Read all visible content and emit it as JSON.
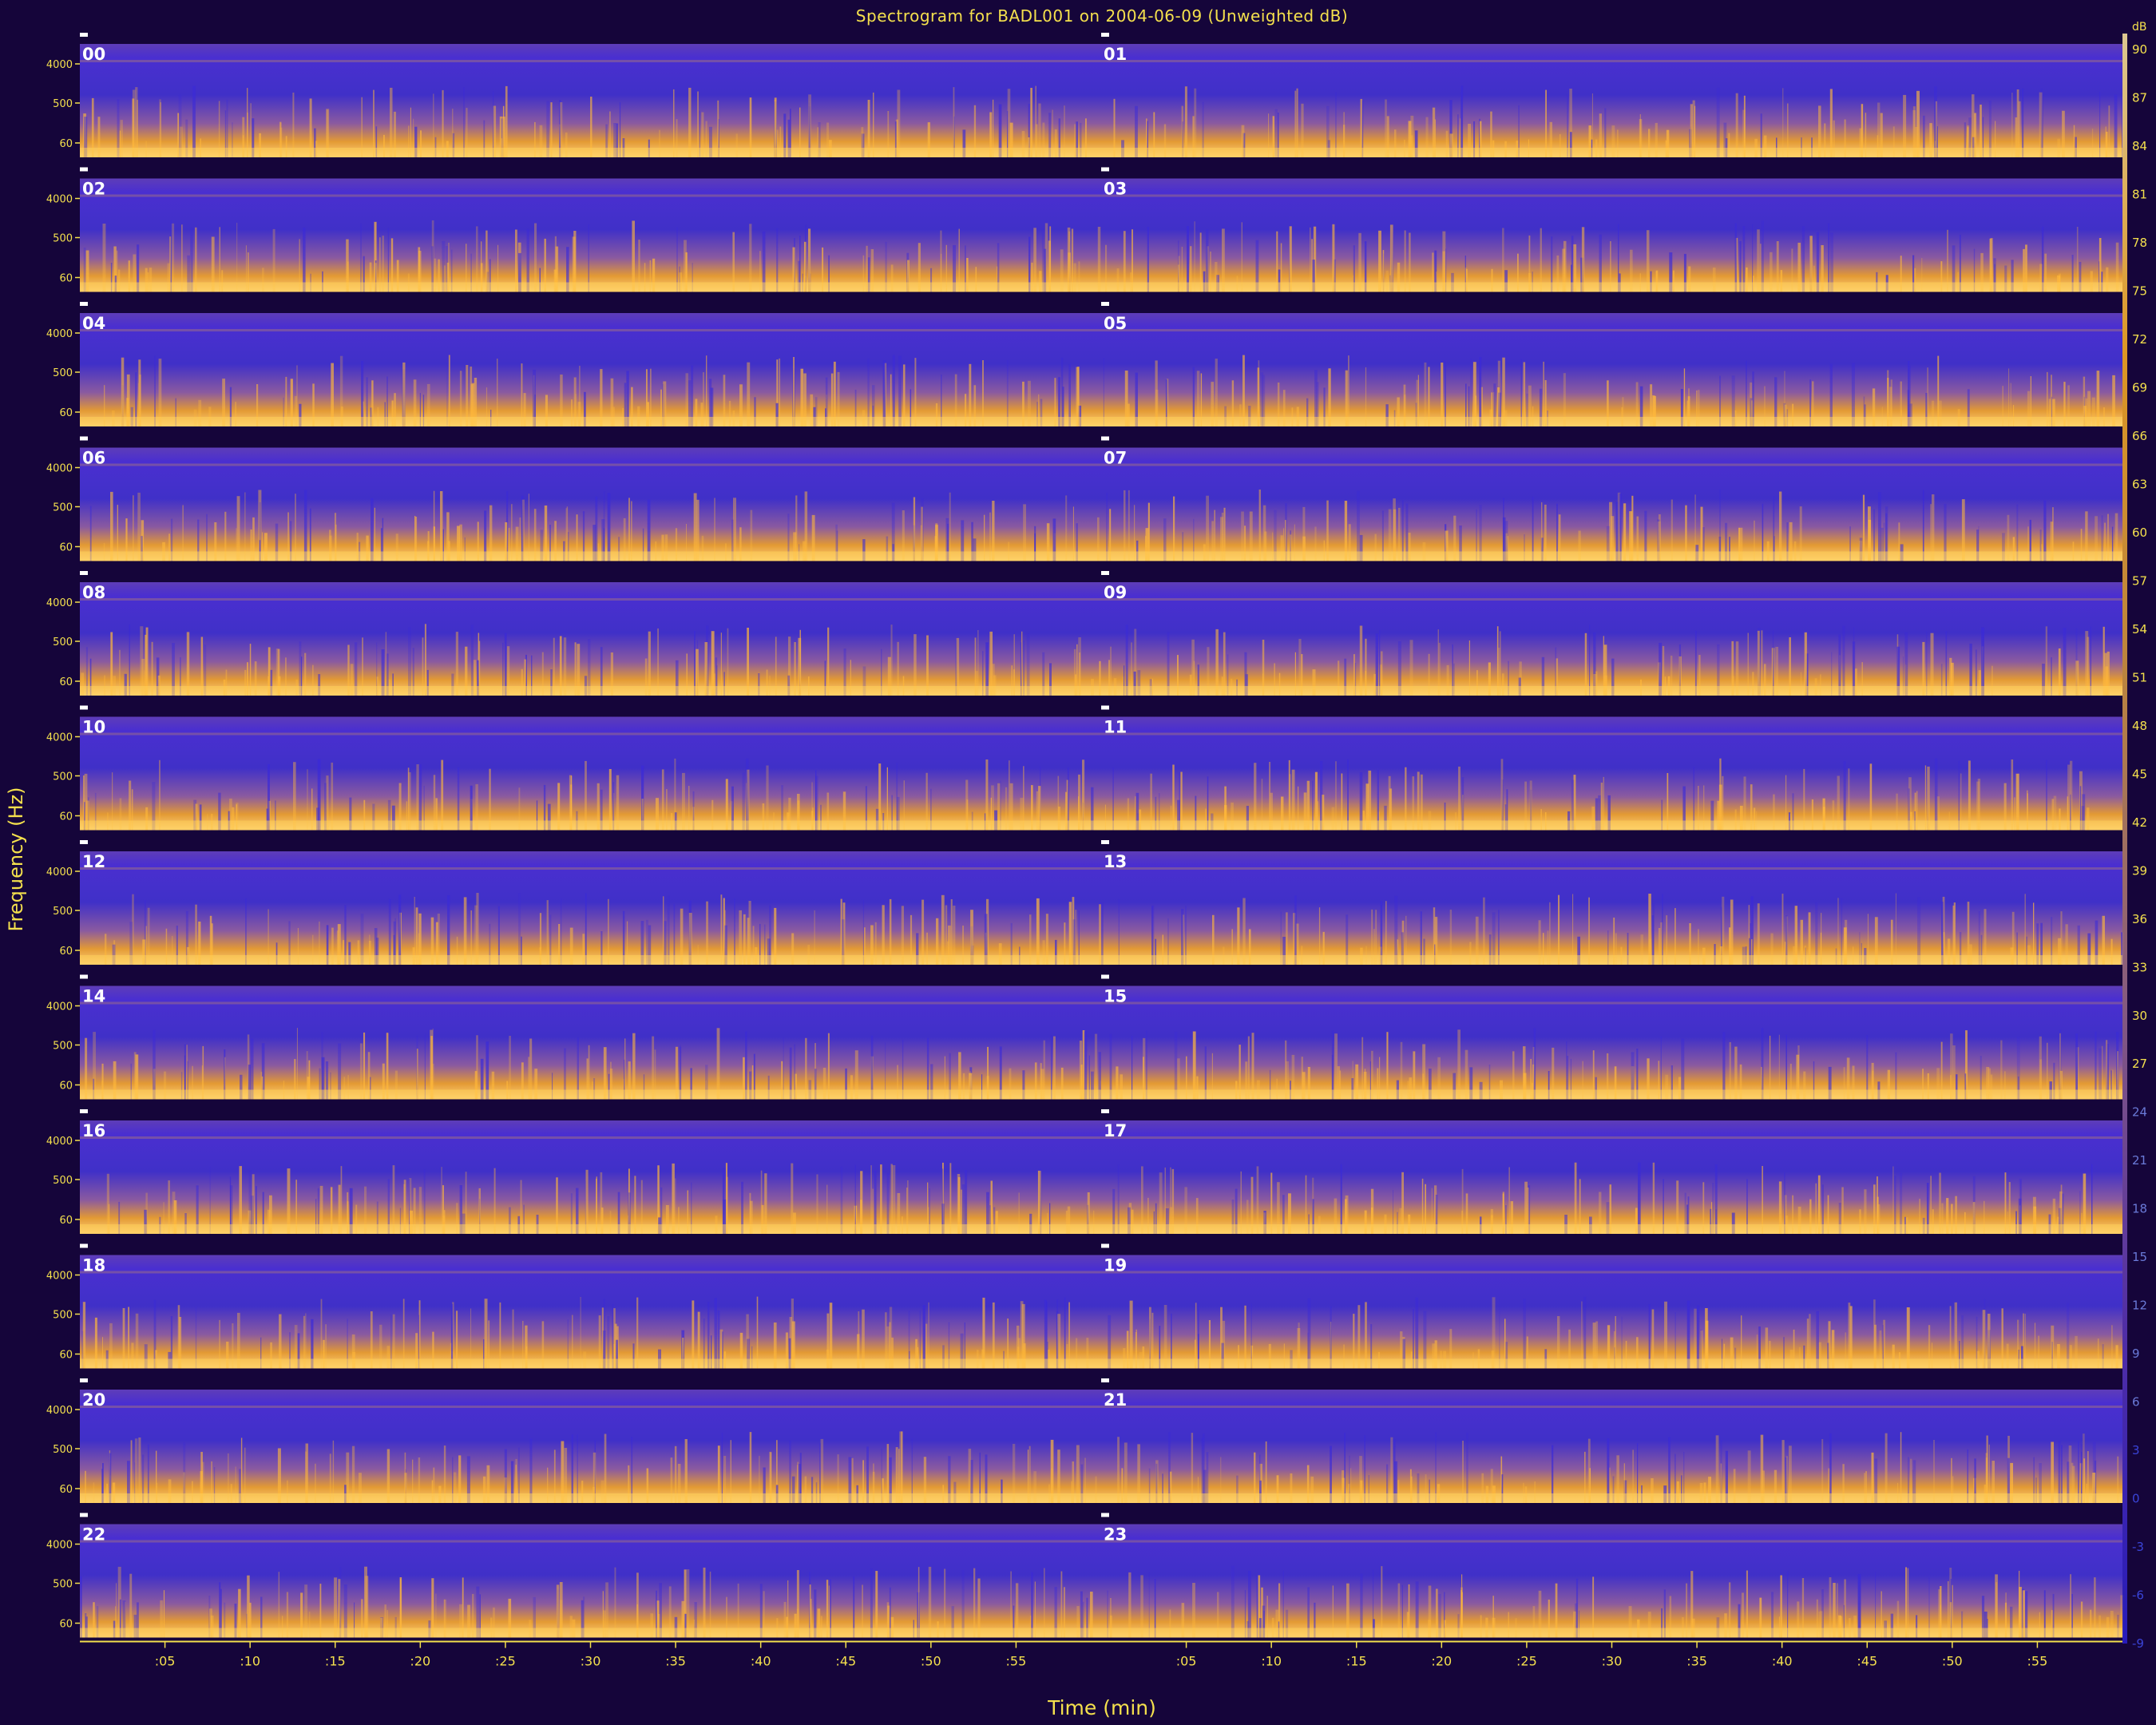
{
  "chart_data": {
    "type": "heatmap",
    "title": "Spectrogram for BADL001 on 2004-06-09 (Unweighted dB)",
    "xlabel": "Time (min)",
    "ylabel": "Frequency (Hz)",
    "hours": [
      "00",
      "01",
      "02",
      "03",
      "04",
      "05",
      "06",
      "07",
      "08",
      "09",
      "10",
      "11",
      "12",
      "13",
      "14",
      "15",
      "16",
      "17",
      "18",
      "19",
      "20",
      "21",
      "22",
      "23"
    ],
    "layout": {
      "rows": 12,
      "columns": 2
    },
    "x_ticks": [
      ":05",
      ":10",
      ":15",
      ":20",
      ":25",
      ":30",
      ":35",
      ":40",
      ":45",
      ":50",
      ":55"
    ],
    "x_range_min": [
      0,
      60
    ],
    "y_ticks": [
      "4000",
      "500",
      "60"
    ],
    "colorbar": {
      "unit": "dB",
      "ticks": [
        "90",
        "87",
        "84",
        "81",
        "78",
        "75",
        "72",
        "69",
        "66",
        "63",
        "60",
        "57",
        "54",
        "51",
        "48",
        "45",
        "42",
        "39",
        "36",
        "33",
        "30",
        "27",
        "24",
        "21",
        "18",
        "15",
        "12",
        "9",
        "6",
        "3",
        "0",
        "-3",
        "-6",
        "-9"
      ],
      "range": [
        -9,
        91
      ],
      "colors": [
        "#2a1fd0",
        "#5c36b8",
        "#9a6a8c",
        "#d89a40",
        "#ffb020",
        "#ffe9a0"
      ]
    }
  }
}
